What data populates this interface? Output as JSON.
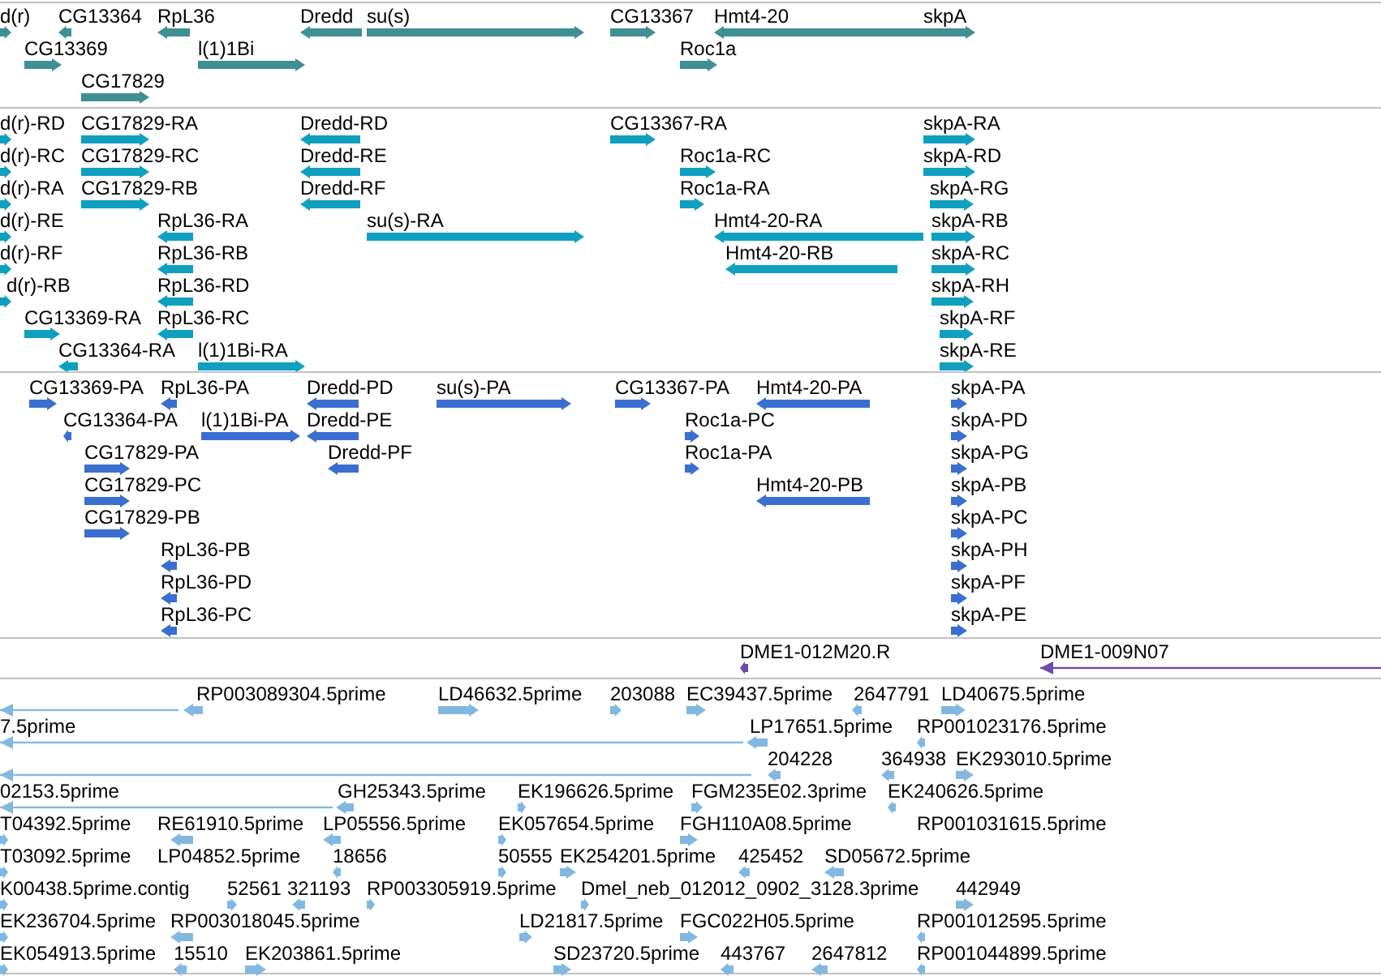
{
  "tracks": [
    {
      "kind": "gene",
      "features": [
        {
          "label": "d(r)",
          "forward": true
        },
        {
          "label": "CG13364",
          "forward": false
        },
        {
          "label": "RpL36",
          "forward": false
        },
        {
          "label": "Dredd",
          "forward": false
        },
        {
          "label": "su(s)",
          "forward": true
        },
        {
          "label": "CG13367",
          "forward": true
        },
        {
          "label": "Hmt4-20",
          "forward": false
        },
        {
          "label": "skpA",
          "forward": true
        },
        {
          "label": "CG13369",
          "forward": true
        },
        {
          "label": "l(1)1Bi",
          "forward": true
        },
        {
          "label": "Roc1a",
          "forward": true
        },
        {
          "label": "CG17829",
          "forward": true
        }
      ]
    },
    {
      "kind": "transcript",
      "features": [
        {
          "label": "d(r)-RD",
          "forward": true
        },
        {
          "label": "CG17829-RA",
          "forward": true
        },
        {
          "label": "Dredd-RD",
          "forward": false
        },
        {
          "label": "CG13367-RA",
          "forward": true
        },
        {
          "label": "skpA-RA",
          "forward": true
        },
        {
          "label": "d(r)-RC",
          "forward": true
        },
        {
          "label": "CG17829-RC",
          "forward": true
        },
        {
          "label": "Dredd-RE",
          "forward": false
        },
        {
          "label": "Roc1a-RC",
          "forward": true
        },
        {
          "label": "skpA-RD",
          "forward": true
        },
        {
          "label": "d(r)-RA",
          "forward": true
        },
        {
          "label": "CG17829-RB",
          "forward": true
        },
        {
          "label": "Dredd-RF",
          "forward": false
        },
        {
          "label": "Roc1a-RA",
          "forward": true
        },
        {
          "label": "skpA-RG",
          "forward": true
        },
        {
          "label": "d(r)-RE",
          "forward": true
        },
        {
          "label": "RpL36-RA",
          "forward": false
        },
        {
          "label": "su(s)-RA",
          "forward": true
        },
        {
          "label": "Hmt4-20-RA",
          "forward": false
        },
        {
          "label": "skpA-RB",
          "forward": true
        },
        {
          "label": "d(r)-RF",
          "forward": true
        },
        {
          "label": "RpL36-RB",
          "forward": false
        },
        {
          "label": "Hmt4-20-RB",
          "forward": false
        },
        {
          "label": "skpA-RC",
          "forward": true
        },
        {
          "label": "d(r)-RB",
          "forward": true
        },
        {
          "label": "RpL36-RD",
          "forward": false
        },
        {
          "label": "skpA-RH",
          "forward": true
        },
        {
          "label": "CG13369-RA",
          "forward": true
        },
        {
          "label": "RpL36-RC",
          "forward": false
        },
        {
          "label": "skpA-RF",
          "forward": true
        },
        {
          "label": "CG13364-RA",
          "forward": false
        },
        {
          "label": "l(1)1Bi-RA",
          "forward": true
        },
        {
          "label": "skpA-RE",
          "forward": true
        }
      ]
    },
    {
      "kind": "protein",
      "features": [
        {
          "label": "CG13369-PA",
          "forward": true
        },
        {
          "label": "RpL36-PA",
          "forward": false
        },
        {
          "label": "Dredd-PD",
          "forward": false
        },
        {
          "label": "su(s)-PA",
          "forward": true
        },
        {
          "label": "CG13367-PA",
          "forward": true
        },
        {
          "label": "Hmt4-20-PA",
          "forward": false
        },
        {
          "label": "skpA-PA",
          "forward": true
        },
        {
          "label": "CG13364-PA",
          "forward": false
        },
        {
          "label": "l(1)1Bi-PA",
          "forward": true
        },
        {
          "label": "Dredd-PE",
          "forward": false
        },
        {
          "label": "Roc1a-PC",
          "forward": true
        },
        {
          "label": "skpA-PD",
          "forward": true
        },
        {
          "label": "CG17829-PA",
          "forward": true
        },
        {
          "label": "Dredd-PF",
          "forward": false
        },
        {
          "label": "Roc1a-PA",
          "forward": true
        },
        {
          "label": "skpA-PG",
          "forward": true
        },
        {
          "label": "CG17829-PC",
          "forward": true
        },
        {
          "label": "Hmt4-20-PB",
          "forward": false
        },
        {
          "label": "skpA-PB",
          "forward": true
        },
        {
          "label": "CG17829-PB",
          "forward": true
        },
        {
          "label": "skpA-PC",
          "forward": true
        },
        {
          "label": "RpL36-PB",
          "forward": false
        },
        {
          "label": "skpA-PH",
          "forward": true
        },
        {
          "label": "RpL36-PD",
          "forward": false
        },
        {
          "label": "skpA-PF",
          "forward": true
        },
        {
          "label": "RpL36-PC",
          "forward": false
        },
        {
          "label": "skpA-PE",
          "forward": true
        }
      ]
    },
    {
      "kind": "bac",
      "features": [
        {
          "label": "DME1-012M20.R",
          "forward": false
        },
        {
          "label": "DME1-009N07",
          "forward": false
        }
      ]
    },
    {
      "kind": "est",
      "features": [
        {
          "forward": false
        },
        {
          "label": "RP003089304.5prime",
          "forward": false
        },
        {
          "label": "LD46632.5prime",
          "forward": true
        },
        {
          "label": "203088",
          "forward": true
        },
        {
          "label": "EC39437.5prime",
          "forward": true
        },
        {
          "label": "2647791",
          "forward": false
        },
        {
          "label": "LD40675.5prime",
          "forward": true
        },
        {
          "label": "7.5prime",
          "forward": false
        },
        {
          "label": "LP17651.5prime",
          "forward": false
        },
        {
          "label": "RP001023176.5prime",
          "forward": false
        },
        {
          "forward": false
        },
        {
          "label": "204228",
          "forward": false
        },
        {
          "label": "364938",
          "forward": false
        },
        {
          "label": "EK293010.5prime",
          "forward": true
        },
        {
          "label": "02153.5prime",
          "forward": false
        },
        {
          "label": "GH25343.5prime",
          "forward": false
        },
        {
          "label": "EK196626.5prime",
          "forward": true
        },
        {
          "label": "FGM235E02.3prime",
          "forward": true
        },
        {
          "label": "EK240626.5prime",
          "forward": false
        },
        {
          "label": "T04392.5prime",
          "forward": true
        },
        {
          "label": "RE61910.5prime",
          "forward": false
        },
        {
          "label": "LP05556.5prime",
          "forward": false
        },
        {
          "label": "EK057654.5prime",
          "forward": true
        },
        {
          "label": "FGH110A08.5prime",
          "forward": true
        },
        {
          "label": "RP001031615.5prime"
        },
        {
          "label": "T03092.5prime",
          "forward": true
        },
        {
          "label": "LP04852.5prime"
        },
        {
          "label": "18656",
          "forward": false
        },
        {
          "label": "50555",
          "forward": true
        },
        {
          "label": "EK254201.5prime",
          "forward": true
        },
        {
          "label": "425452",
          "forward": false
        },
        {
          "label": "SD05672.5prime",
          "forward": false
        },
        {
          "label": "K00438.5prime.contig",
          "forward": true
        },
        {
          "label": "52561",
          "forward": true
        },
        {
          "label": "321193",
          "forward": false
        },
        {
          "label": "RP003305919.5prime",
          "forward": true
        },
        {
          "label": "Dmel_neb_012012_0902_3128.3prime",
          "forward": true
        },
        {
          "label": "442949",
          "forward": true
        },
        {
          "label": "EK236704.5prime",
          "forward": true
        },
        {
          "label": "RP003018045.5prime",
          "forward": false
        },
        {
          "label": "LD21817.5prime",
          "forward": true
        },
        {
          "label": "FGC022H05.5prime",
          "forward": true
        },
        {
          "label": "RP001012595.5prime",
          "forward": false
        },
        {
          "label": "EK054913.5prime",
          "forward": true
        },
        {
          "label": "15510",
          "forward": false
        },
        {
          "label": "EK203861.5prime",
          "forward": true
        },
        {
          "label": "SD23720.5prime",
          "forward": true
        },
        {
          "label": "443767",
          "forward": false
        },
        {
          "label": "2647812",
          "forward": false
        },
        {
          "label": "RP001044899.5prime",
          "forward": false
        }
      ]
    }
  ]
}
